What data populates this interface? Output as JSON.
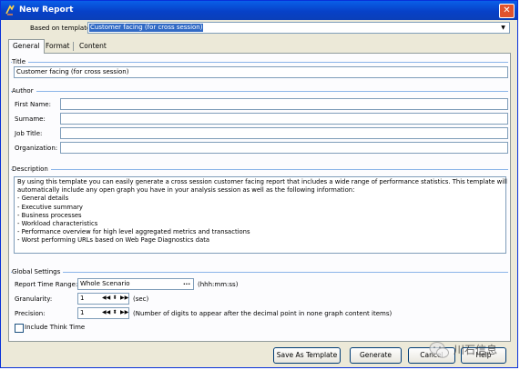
{
  "window": {
    "title": "New Report",
    "close_label": "✕"
  },
  "template": {
    "label": "Based on template",
    "value": "Customer facing (for cross session)"
  },
  "tabs": [
    {
      "label": "General"
    },
    {
      "label": "Format"
    },
    {
      "label": "Content"
    }
  ],
  "title_group": {
    "label": "Title",
    "value": "Customer facing (for cross session)"
  },
  "author_group": {
    "label": "Author",
    "first_name_label": "First Name:",
    "surname_label": "Surname:",
    "job_title_label": "Job Title:",
    "organization_label": "Organization:"
  },
  "description_group": {
    "label": "Description",
    "lines": [
      "By using this template you can easily generate a cross session customer facing report that includes a wide range of performance statistics. This template will",
      "automatically include any open graph you have in your analysis session as well as the following information:",
      "- General details",
      "- Executive summary",
      "- Business processes",
      "- Workload characteristics",
      "- Performance overview for high level aggregated metrics and transactions",
      "- Worst performing URLs based on Web Page Diagnostics data"
    ]
  },
  "global_settings": {
    "label": "Global Settings",
    "time_range_label": "Report Time Range:",
    "time_range_value": "Whole Scenario",
    "time_range_button": "...",
    "time_format": "(hhh:mm:ss)",
    "granularity_label": "Granularity:",
    "granularity_value": "1",
    "granularity_unit": "(sec)",
    "precision_label": "Precision:",
    "precision_value": "1",
    "precision_note": "(Number of digits to appear after the decimal point in none graph content items)",
    "think_time_label": "Include Think Time"
  },
  "buttons": {
    "save_template": "Save As Template",
    "generate": "Generate",
    "cancel": "Cancel",
    "help": "Help"
  },
  "watermark": {
    "text": "川石信息"
  },
  "colors": {
    "titlebar": "#0a4fd8",
    "panel_line": "#8ab4e8",
    "selection": "#316ac5"
  }
}
